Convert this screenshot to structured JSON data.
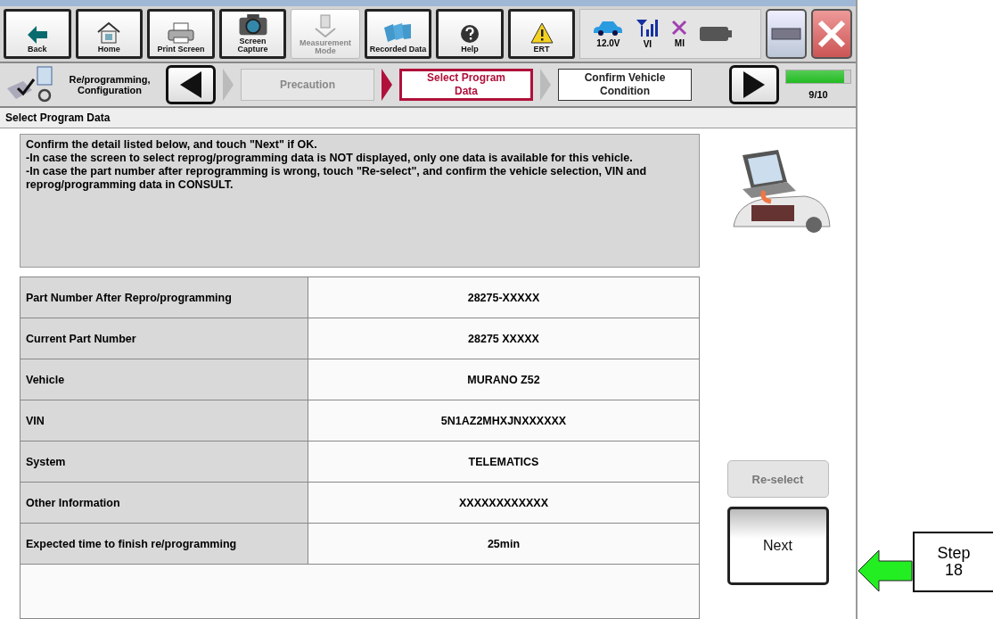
{
  "toolbar": {
    "buttons": [
      {
        "label": "Back",
        "kind": "back",
        "disabled": false
      },
      {
        "label": "Home",
        "kind": "home",
        "disabled": false
      },
      {
        "label": "Print Screen",
        "kind": "print",
        "disabled": false
      },
      {
        "label": "Screen Capture",
        "kind": "camera",
        "disabled": false
      },
      {
        "label": "Measurement Mode",
        "kind": "meter",
        "disabled": true
      },
      {
        "label": "Recorded Data",
        "kind": "folders",
        "disabled": false
      },
      {
        "label": "Help",
        "kind": "help",
        "disabled": false
      },
      {
        "label": "ERT",
        "kind": "warning",
        "disabled": false
      }
    ],
    "status": [
      {
        "label": "12.0V",
        "kind": "car"
      },
      {
        "label": "VI",
        "kind": "signal"
      },
      {
        "label": "MI",
        "kind": "cross"
      },
      {
        "kind": "battery"
      }
    ]
  },
  "steps": {
    "title": "Re/programming, Configuration",
    "items": [
      {
        "label": "Precaution",
        "selected": false,
        "done": true
      },
      {
        "label": "Select Program Data",
        "selected": true,
        "done": false
      },
      {
        "label": "Confirm Vehicle Condition",
        "selected": false,
        "done": false
      }
    ],
    "progress": {
      "level": 0.9,
      "label": "9/10"
    }
  },
  "page_title": "Select Program Data",
  "instructions": [
    "Confirm the detail listed below, and touch \"Next\" if OK.",
    "-In case the screen to select reprog/programming data is NOT displayed, only one data is available for this vehicle.",
    "-In case the part number after reprogramming is wrong, touch \"Re-select\", and confirm the vehicle selection, VIN and reprog/programming data in CONSULT."
  ],
  "table": {
    "rows": [
      {
        "label": "Part Number After Repro/programming",
        "value": "28275-XXXXX"
      },
      {
        "label": "Current Part Number",
        "value": "28275 XXXXX"
      },
      {
        "label": "Vehicle",
        "value": "MURANO Z52"
      },
      {
        "label": "VIN",
        "value": "5N1AZ2MHXJNXXXXXX"
      },
      {
        "label": "System",
        "value": "TELEMATICS"
      },
      {
        "label": "Other Information",
        "value": "XXXXXXXXXXXX"
      },
      {
        "label": "Expected time to finish re/programming",
        "value": "25min"
      }
    ]
  },
  "buttons": [
    {
      "label": "Re-select",
      "disabled": true
    },
    {
      "label": "Next",
      "disabled": false
    }
  ],
  "callout": [
    "Step",
    "18"
  ]
}
